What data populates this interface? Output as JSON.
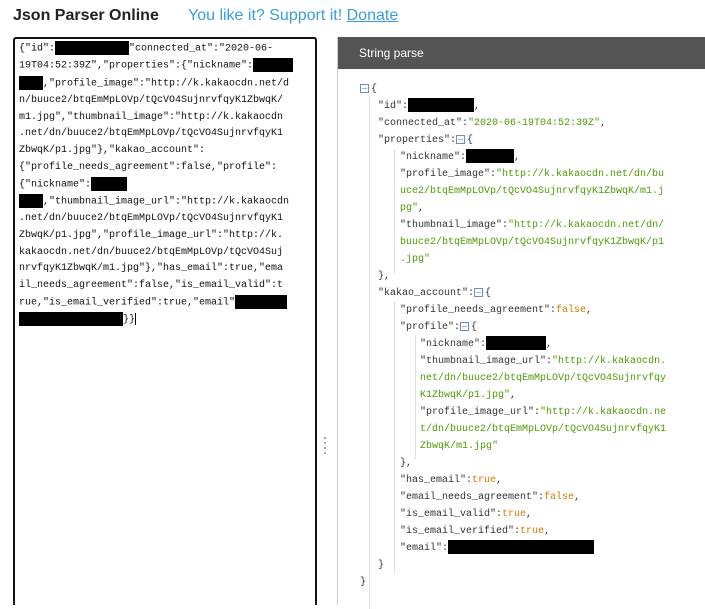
{
  "header": {
    "title": "Json Parser Online",
    "support_text": "You like it? Support it!",
    "donate_label": "Donate"
  },
  "editor": {
    "lines": [
      [
        "{\"id\":",
        "",
        "\"connected_at\":\"2020-06-"
      ],
      [
        "19T04:52:39Z\",\"properties\":{\"nickname\":",
        ""
      ],
      [
        "",
        ",\"profile_image\":\"http://k.kakaocdn.net/d"
      ],
      [
        "n/buuce2/btqEmMpLOVp/tQcVO4SujnrvfqyK1ZbwqK/"
      ],
      [
        "m1.jpg\",\"thumbnail_image\":\"http://k.kakaocdn"
      ],
      [
        ".net/dn/buuce2/btqEmMpLOVp/tQcVO4SujnrvfqyK1"
      ],
      [
        "ZbwqK/p1.jpg\"},\"kakao_account\":"
      ],
      [
        "{\"profile_needs_agreement\":false,\"profile\":"
      ],
      [
        "{\"nickname\":",
        ""
      ],
      [
        "",
        ",\"thumbnail_image_url\":\"http://k.kakaocdn"
      ],
      [
        ".net/dn/buuce2/btqEmMpLOVp/tQcVO4SujnrvfqyK1"
      ],
      [
        "ZbwqK/p1.jpg\",\"profile_image_url\":\"http://k."
      ],
      [
        "kakaocdn.net/dn/buuce2/btqEmMpLOVp/tQcVO4Suj"
      ],
      [
        "nrvfqyK1ZbwqK/m1.jpg\"},\"has_email\":true,\"ema"
      ],
      [
        "il_needs_agreement\":false,\"is_email_valid\":t"
      ],
      [
        "rue,\"is_email_verified\":true,\"email\"",
        ""
      ],
      [
        "",
        "}}"
      ]
    ]
  },
  "panel": {
    "title": "String parse",
    "toggle_symbol": "−",
    "tree": {
      "open_brace": "{",
      "close_brace": "}",
      "id_key": "\"id\"",
      "connected_at_key": "\"connected_at\"",
      "connected_at_value": "\"2020-06-19T04:52:39Z\"",
      "properties_key": "\"properties\"",
      "nickname_key": "\"nickname\"",
      "profile_image_key": "\"profile_image\"",
      "profile_image_value_1": "\"http://k.kakaocdn.net/dn/bu",
      "profile_image_value_2": "uce2/btqEmMpLOVp/tQcVO4SujnrvfqyK1ZbwqK/m1.j",
      "profile_image_value_3": "pg\"",
      "thumbnail_image_key": "\"thumbnail_image\"",
      "thumbnail_image_value_1": "\"http://k.kakaocdn.net/dn/",
      "thumbnail_image_value_2": "buuce2/btqEmMpLOVp/tQcVO4SujnrvfqyK1ZbwqK/p1",
      "thumbnail_image_value_3": ".jpg\"",
      "properties_close": "},",
      "kakao_account_key": "\"kakao_account\"",
      "profile_needs_agreement_key": "\"profile_needs_agreement\"",
      "false_value": "false",
      "true_value": "true",
      "profile_key": "\"profile\"",
      "thumbnail_image_url_key": "\"thumbnail_image_url\"",
      "thumbnail_image_url_value_1": "\"http://k.kakaocdn.",
      "thumbnail_image_url_value_2": "net/dn/buuce2/btqEmMpLOVp/tQcVO4Sujnrvfqy",
      "thumbnail_image_url_value_3": "K1ZbwqK/p1.jpg\"",
      "profile_image_url_key": "\"profile_image_url\"",
      "profile_image_url_value_1": "\"http://k.kakaocdn.ne",
      "profile_image_url_value_2": "t/dn/buuce2/btqEmMpLOVp/tQcVO4SujnrvfqyK1",
      "profile_image_url_value_3": "ZbwqK/m1.jpg\"",
      "profile_close": "},",
      "has_email_key": "\"has_email\"",
      "email_needs_agreement_key": "\"email_needs_agreement\"",
      "is_email_valid_key": "\"is_email_valid\"",
      "is_email_verified_key": "\"is_email_verified\"",
      "email_key": "\"email\"",
      "account_close": "}",
      "root_close": "}"
    }
  }
}
